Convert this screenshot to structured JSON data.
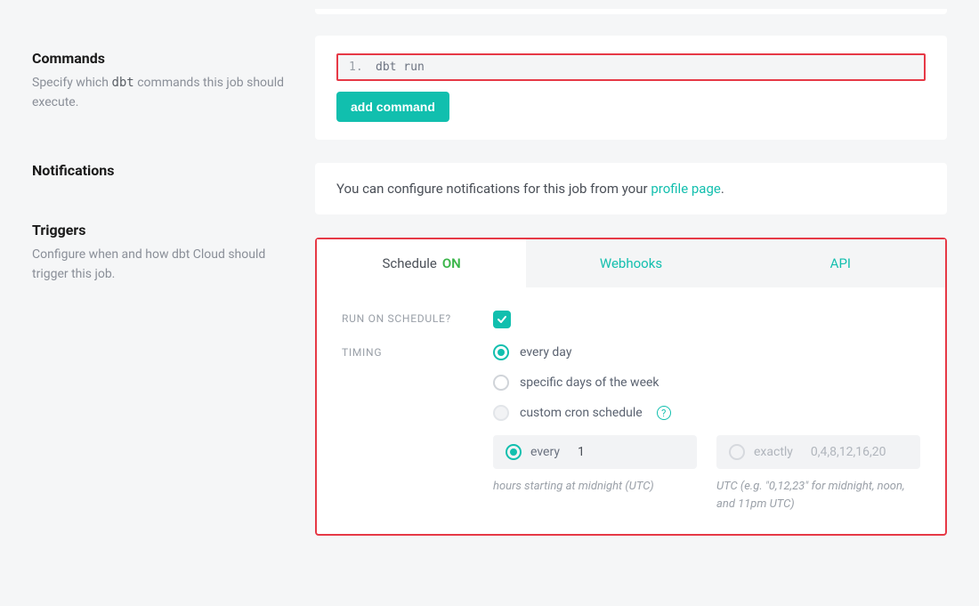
{
  "commands": {
    "title": "Commands",
    "desc_pre": "Specify which ",
    "desc_code": "dbt",
    "desc_post": " commands this job should execute.",
    "list": [
      {
        "idx": "1.",
        "cmd": "dbt run"
      }
    ],
    "add_btn": "add command"
  },
  "notifications": {
    "title": "Notifications",
    "text_pre": "You can configure notifications for this job from your ",
    "link": "profile page",
    "text_post": "."
  },
  "triggers": {
    "title": "Triggers",
    "desc": "Configure when and how dbt Cloud should trigger this job.",
    "tabs": {
      "schedule": "Schedule",
      "schedule_on": "ON",
      "webhooks": "Webhooks",
      "api": "API"
    },
    "run_on_schedule_label": "Run on schedule?",
    "timing_label": "Timing",
    "timing_options": {
      "every_day": "every day",
      "specific_days": "specific days of the week",
      "custom_cron": "custom cron schedule"
    },
    "interval": {
      "every_label": "every",
      "every_value": "1",
      "exactly_label": "exactly",
      "exactly_placeholder": "0,4,8,12,16,20"
    },
    "hints": {
      "every": "hours starting at midnight (UTC)",
      "exactly": "UTC (e.g. \"0,12,23\" for midnight, noon, and 11pm UTC)"
    }
  }
}
